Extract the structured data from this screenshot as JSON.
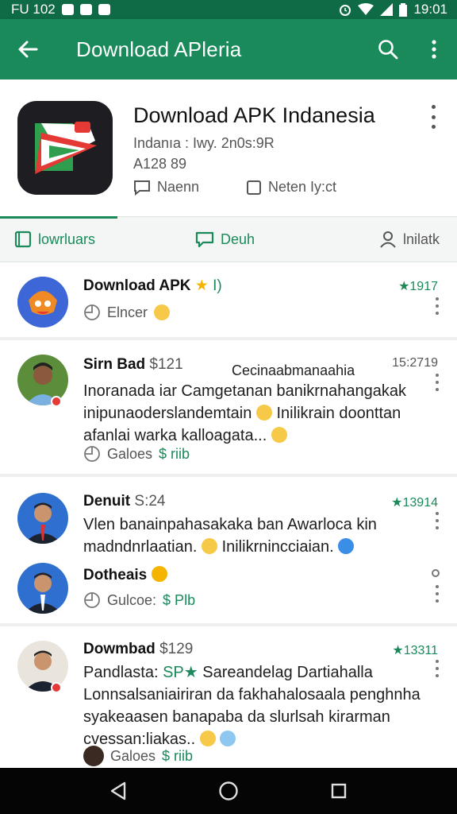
{
  "status_bar": {
    "left_text": "FU 102",
    "time": "19:01"
  },
  "app_bar": {
    "title": "Download APleria"
  },
  "app": {
    "name": "Download APK Indanesia",
    "meta": "Indanıa : Iwy. 2n0s:9R",
    "size": "A128 89",
    "chip_1": "Naenn",
    "chip_2": "Neten Iy:ct"
  },
  "tabs": [
    {
      "label": "lowrluars",
      "active": true
    },
    {
      "label": "Deuh",
      "active": false
    },
    {
      "label": "lnilatk",
      "active": false
    }
  ],
  "posts": [
    {
      "name": "Download APK",
      "suffix": "I)",
      "score": "★1917",
      "footer": "Elncer"
    },
    {
      "name": "Sirn Bad",
      "amount": "$121",
      "header_extra": "Cecinaabmanaahia",
      "time": "15:2719",
      "lines": [
        "Inoranada iar Camgetanan banikrnahangakak",
        "inipunaoderslandemtain",
        "afanlai warka kalloagata..."
      ],
      "line2_tail": "Inilikrain doonttan",
      "footer": "Galoes",
      "footer_green": "$ riib"
    },
    {
      "name": "Denuit",
      "amount": "S:24",
      "score": "★13914",
      "lines": [
        "Vlen banainpahasakaka ban Awarloca kin",
        "madndnrlaatian.",
        "Inilikrnincciaian."
      ]
    },
    {
      "name": "Dotheais",
      "footer": "Gulcoe:",
      "footer_green": "$ Plb"
    },
    {
      "name": "Dowmbad",
      "amount": "$129",
      "score": "★13311",
      "title_a": "Pandlasta:",
      "title_b": "SP",
      "title_c": "Sareandelag Dartiahalla",
      "lines": [
        "Lonnsalsaniairiran da fakhahalosaala penghnha",
        "syakeaasen banapaba da slurlsah kirarman",
        "cvessan:liakas.."
      ],
      "footer": "Galoes",
      "footer_green": "$ riib"
    }
  ],
  "colors": {
    "primary": "#1a8a5a",
    "status_bar": "#0f6b45",
    "nav_bar": "#050505"
  }
}
